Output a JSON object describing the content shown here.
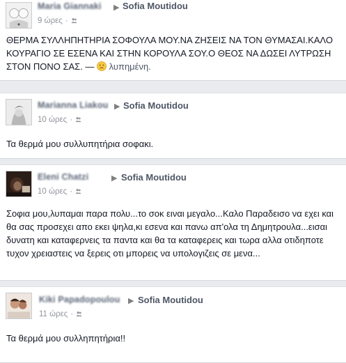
{
  "posts": [
    {
      "author": "Maria Giannaki",
      "target": "Sofia Moutidou",
      "time": "9 ώρες",
      "text": "ΘΕΡΜΑ ΣΥΛΛΗΠΗΤΗΡΙΑ ΣΟΦΟΥΛΑ ΜΟΥ.ΝΑ ΖΗΣΕΙΣ ΝΑ ΤΟΝ ΘΥΜΑΣΑΙ.ΚΑΛΟ ΚΟΥΡΑΓΙΟ ΣΕ ΕΣΕΝΑ ΚΑΙ ΣΤΗΝ ΚΟΡΟΥΛΑ ΣΟΥ.Ο ΘΕΟΣ ΝΑ ΔΩΣΕΙ ΛΥΤΡΩΣΗ ΣΤΟΝ ΠΟΝΟ ΣΑΣ. — ",
      "feeling": "λυπημένη."
    },
    {
      "author": "Marianna Liakou",
      "target": "Sofia Moutidou",
      "time": "10 ώρες",
      "text": "Τα θερμά μου συλλυπητήρια σοφακι."
    },
    {
      "author": "Eleni Chatzi",
      "target": "Sofia Moutidou",
      "time": "10 ώρες",
      "text": "Σοφια μου,λυπαμαι παρα πολυ...το σοκ ειναι μεγαλο...Καλο Παραδεισο να εχει και θα σας προσεχει απο εκει ψηλα,κι εσενα και πανω απ'ολα τη Δημητρουλα...εισαι δυνατη και καταφερνεις τα παντα και θα τα καταφερεις και τωρα αλλα οτιδηποτε τυχον χρειαστεις να ξερεις οτι μπορεις να υπολογιζεις σε μενα..."
    },
    {
      "author": "Kiki Papadopoulou",
      "target": "Sofia Moutidou",
      "time": "11 ώρες",
      "text": "Τα θερμά μου συλληπητήρια!!"
    }
  ],
  "icons": {
    "arrow": "right-triangle-icon",
    "privacy": "friends-icon",
    "emoji": "sad-face-icon"
  },
  "colors": {
    "link": "#4e5665",
    "meta": "#90949c",
    "background": "#e9ebee"
  }
}
